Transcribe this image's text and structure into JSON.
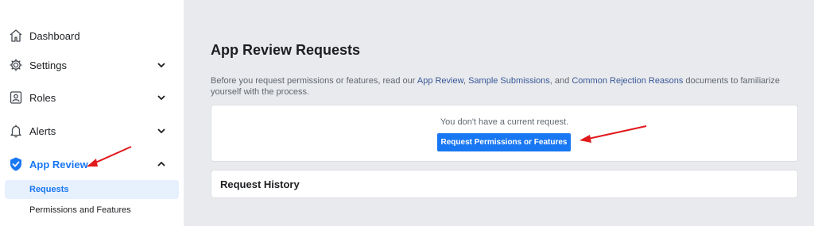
{
  "sidebar": {
    "items": [
      {
        "label": "Dashboard",
        "icon": "home-icon"
      },
      {
        "label": "Settings",
        "icon": "gear-icon",
        "chevron": "down"
      },
      {
        "label": "Roles",
        "icon": "user-badge-icon",
        "chevron": "down"
      },
      {
        "label": "Alerts",
        "icon": "bell-icon",
        "chevron": "down"
      },
      {
        "label": "App Review",
        "icon": "shield-check-icon",
        "chevron": "up",
        "active": true
      }
    ],
    "subitems": [
      {
        "label": "Requests",
        "active": true
      },
      {
        "label": "Permissions and Features"
      }
    ]
  },
  "main": {
    "title": "App Review Requests",
    "intro": {
      "part1": "Before you request permissions or features, read our ",
      "link1": "App Review",
      "sep1": ", ",
      "link2": "Sample Submissions",
      "sep2": ", and ",
      "link3": "Common Rejection Reasons",
      "part2": " documents to familiarize yourself with the process."
    },
    "request_card": {
      "empty_text": "You don't have a current request.",
      "button_label": "Request Permissions or Features"
    },
    "history_card": {
      "title": "Request History"
    }
  },
  "colors": {
    "accent": "#1877f2",
    "annotation": "#e0191c",
    "link": "#385898"
  }
}
